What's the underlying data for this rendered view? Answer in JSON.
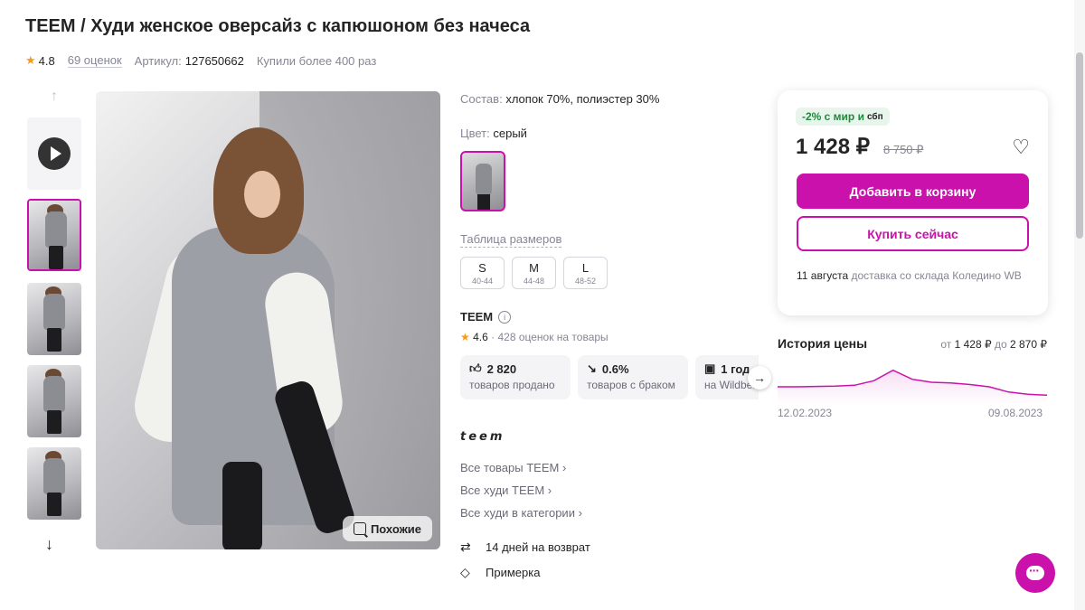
{
  "product": {
    "title": "TEEM / Худи женское оверсайз с капюшоном без начеса",
    "rating": "4.8",
    "reviews": "69 оценок",
    "article_label": "Артикул:",
    "article": "127650662",
    "bought": "Купили более 400 раз"
  },
  "gallery": {
    "similar_label": "Похожие",
    "icons": {
      "up": "arrow-up-icon",
      "down": "arrow-down-icon",
      "play": "play-icon"
    }
  },
  "info": {
    "composition_label": "Состав:",
    "composition": "хлопок 70%, полиэстер 30%",
    "color_label": "Цвет:",
    "color": "серый",
    "size_table": "Таблица размеров",
    "sizes": [
      {
        "size": "S",
        "range": "40-44"
      },
      {
        "size": "M",
        "range": "44-48"
      },
      {
        "size": "L",
        "range": "48-52"
      }
    ],
    "brand": "TEEM",
    "brand_rating": "4.6",
    "brand_reviews": "· 428 оценок на товары",
    "stats": [
      {
        "value": "2 820",
        "label": "товаров продано",
        "icon": "thumbs-up-icon"
      },
      {
        "value": "0.6%",
        "label": "товаров с браком",
        "icon": "trend-down-icon"
      },
      {
        "value": "1 год",
        "label": "на Wildberries",
        "icon": "store-icon"
      }
    ],
    "brand_logo": "teem",
    "links": [
      "Все товары TEEM ›",
      "Все худи TEEM ›",
      "Все худи в категории ›"
    ],
    "return": "14 дней на возврат",
    "fitting": "Примерка"
  },
  "purchase": {
    "promo": "-2% с мир и",
    "promo_sbp": "сбп",
    "price": "1 428 ₽",
    "old_price": "8 750 ₽",
    "add_to_cart": "Добавить в корзину",
    "buy_now": "Купить сейчас",
    "delivery_date": "11 августа",
    "delivery_text": "доставка со склада Коледино WB"
  },
  "price_history": {
    "title": "История цены",
    "range_from_label": "от",
    "range_from": "1 428 ₽",
    "range_to_label": "до",
    "range_to": "2 870 ₽",
    "date_start": "12.02.2023",
    "date_end": "09.08.2023"
  },
  "colors": {
    "accent": "#cb11ab",
    "promo_bg": "#e8f5ec",
    "promo_text": "#1f8a3c",
    "star": "#f59b1a"
  },
  "chart_data": {
    "type": "line",
    "x": [
      "12.02.2023",
      "",
      "",
      "",
      "",
      "",
      "",
      "",
      "",
      "",
      "",
      "",
      "",
      "",
      "09.08.2023"
    ],
    "values": [
      1540,
      1540,
      1545,
      1550,
      1560,
      1620,
      1760,
      1640,
      1600,
      1590,
      1570,
      1540,
      1470,
      1440,
      1428
    ],
    "title": "История цены",
    "grid": false
  }
}
